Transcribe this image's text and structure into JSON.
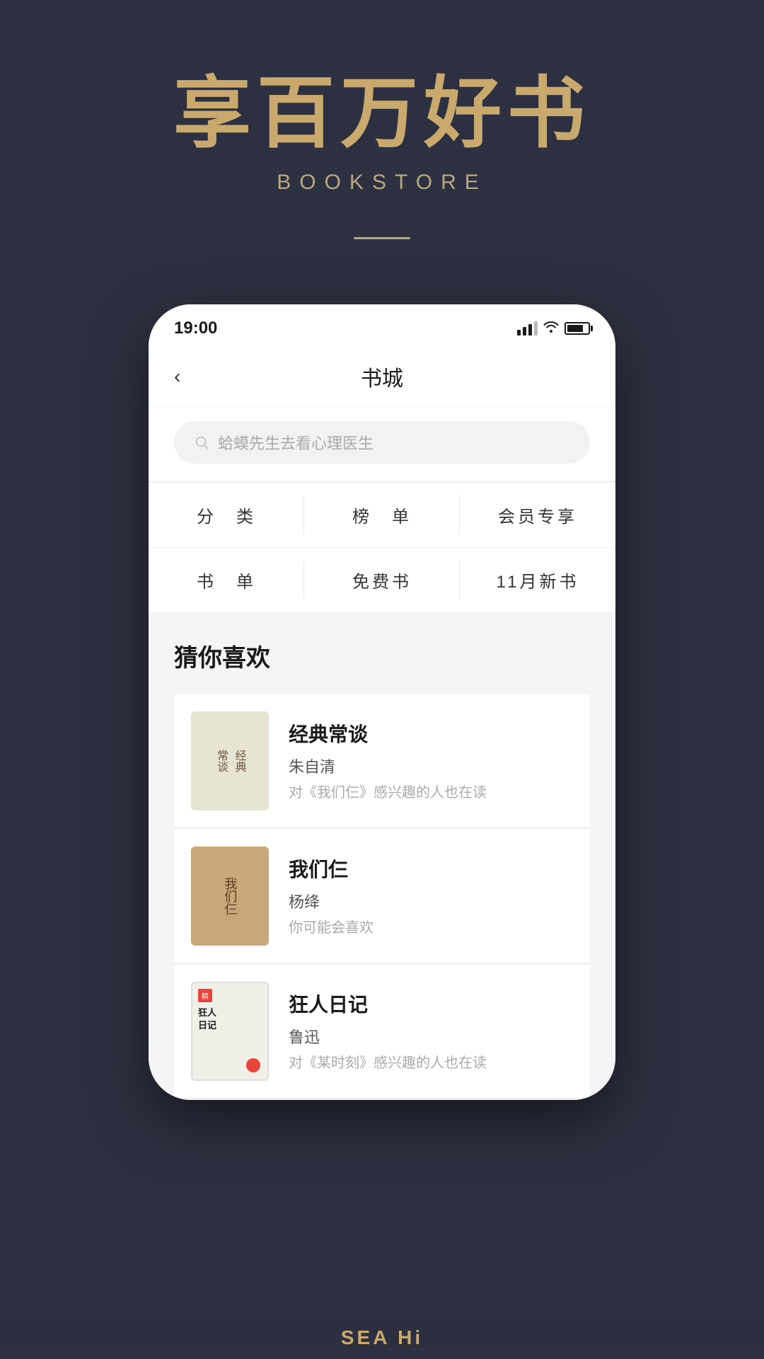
{
  "app": {
    "main_title": "享百万好书",
    "sub_title": "BOOKSTORE",
    "background_color": "#2d3040",
    "gold_color": "#c9a96e"
  },
  "status_bar": {
    "time": "19:00",
    "signal_label": "signal",
    "wifi_label": "wifi",
    "battery_label": "battery"
  },
  "nav": {
    "title": "书城",
    "back_label": "‹"
  },
  "search": {
    "placeholder": "蛤蟆先生去看心理医生"
  },
  "categories": [
    {
      "label": "分　类"
    },
    {
      "label": "榜　单"
    },
    {
      "label": "会员专享"
    },
    {
      "label": "书　单"
    },
    {
      "label": "免费书"
    },
    {
      "label": "11月新书"
    }
  ],
  "recommendations": {
    "section_title": "猜你喜欢",
    "books": [
      {
        "title": "经典常谈",
        "author": "朱自清",
        "description": "对《我们仨》感兴趣的人也在读",
        "cover_type": "cover1",
        "cover_text": "经典常谈"
      },
      {
        "title": "我们仨",
        "author": "杨绛",
        "description": "你可能会喜欢",
        "cover_type": "cover2",
        "cover_text": "我们仨"
      },
      {
        "title": "狂人日记",
        "author": "鲁迅",
        "description": "对《某时刻》感兴趣的人也在读",
        "cover_type": "cover3",
        "cover_text": "狂人日记"
      }
    ]
  },
  "bottom": {
    "sea_hi_text": "SEA Hi"
  }
}
